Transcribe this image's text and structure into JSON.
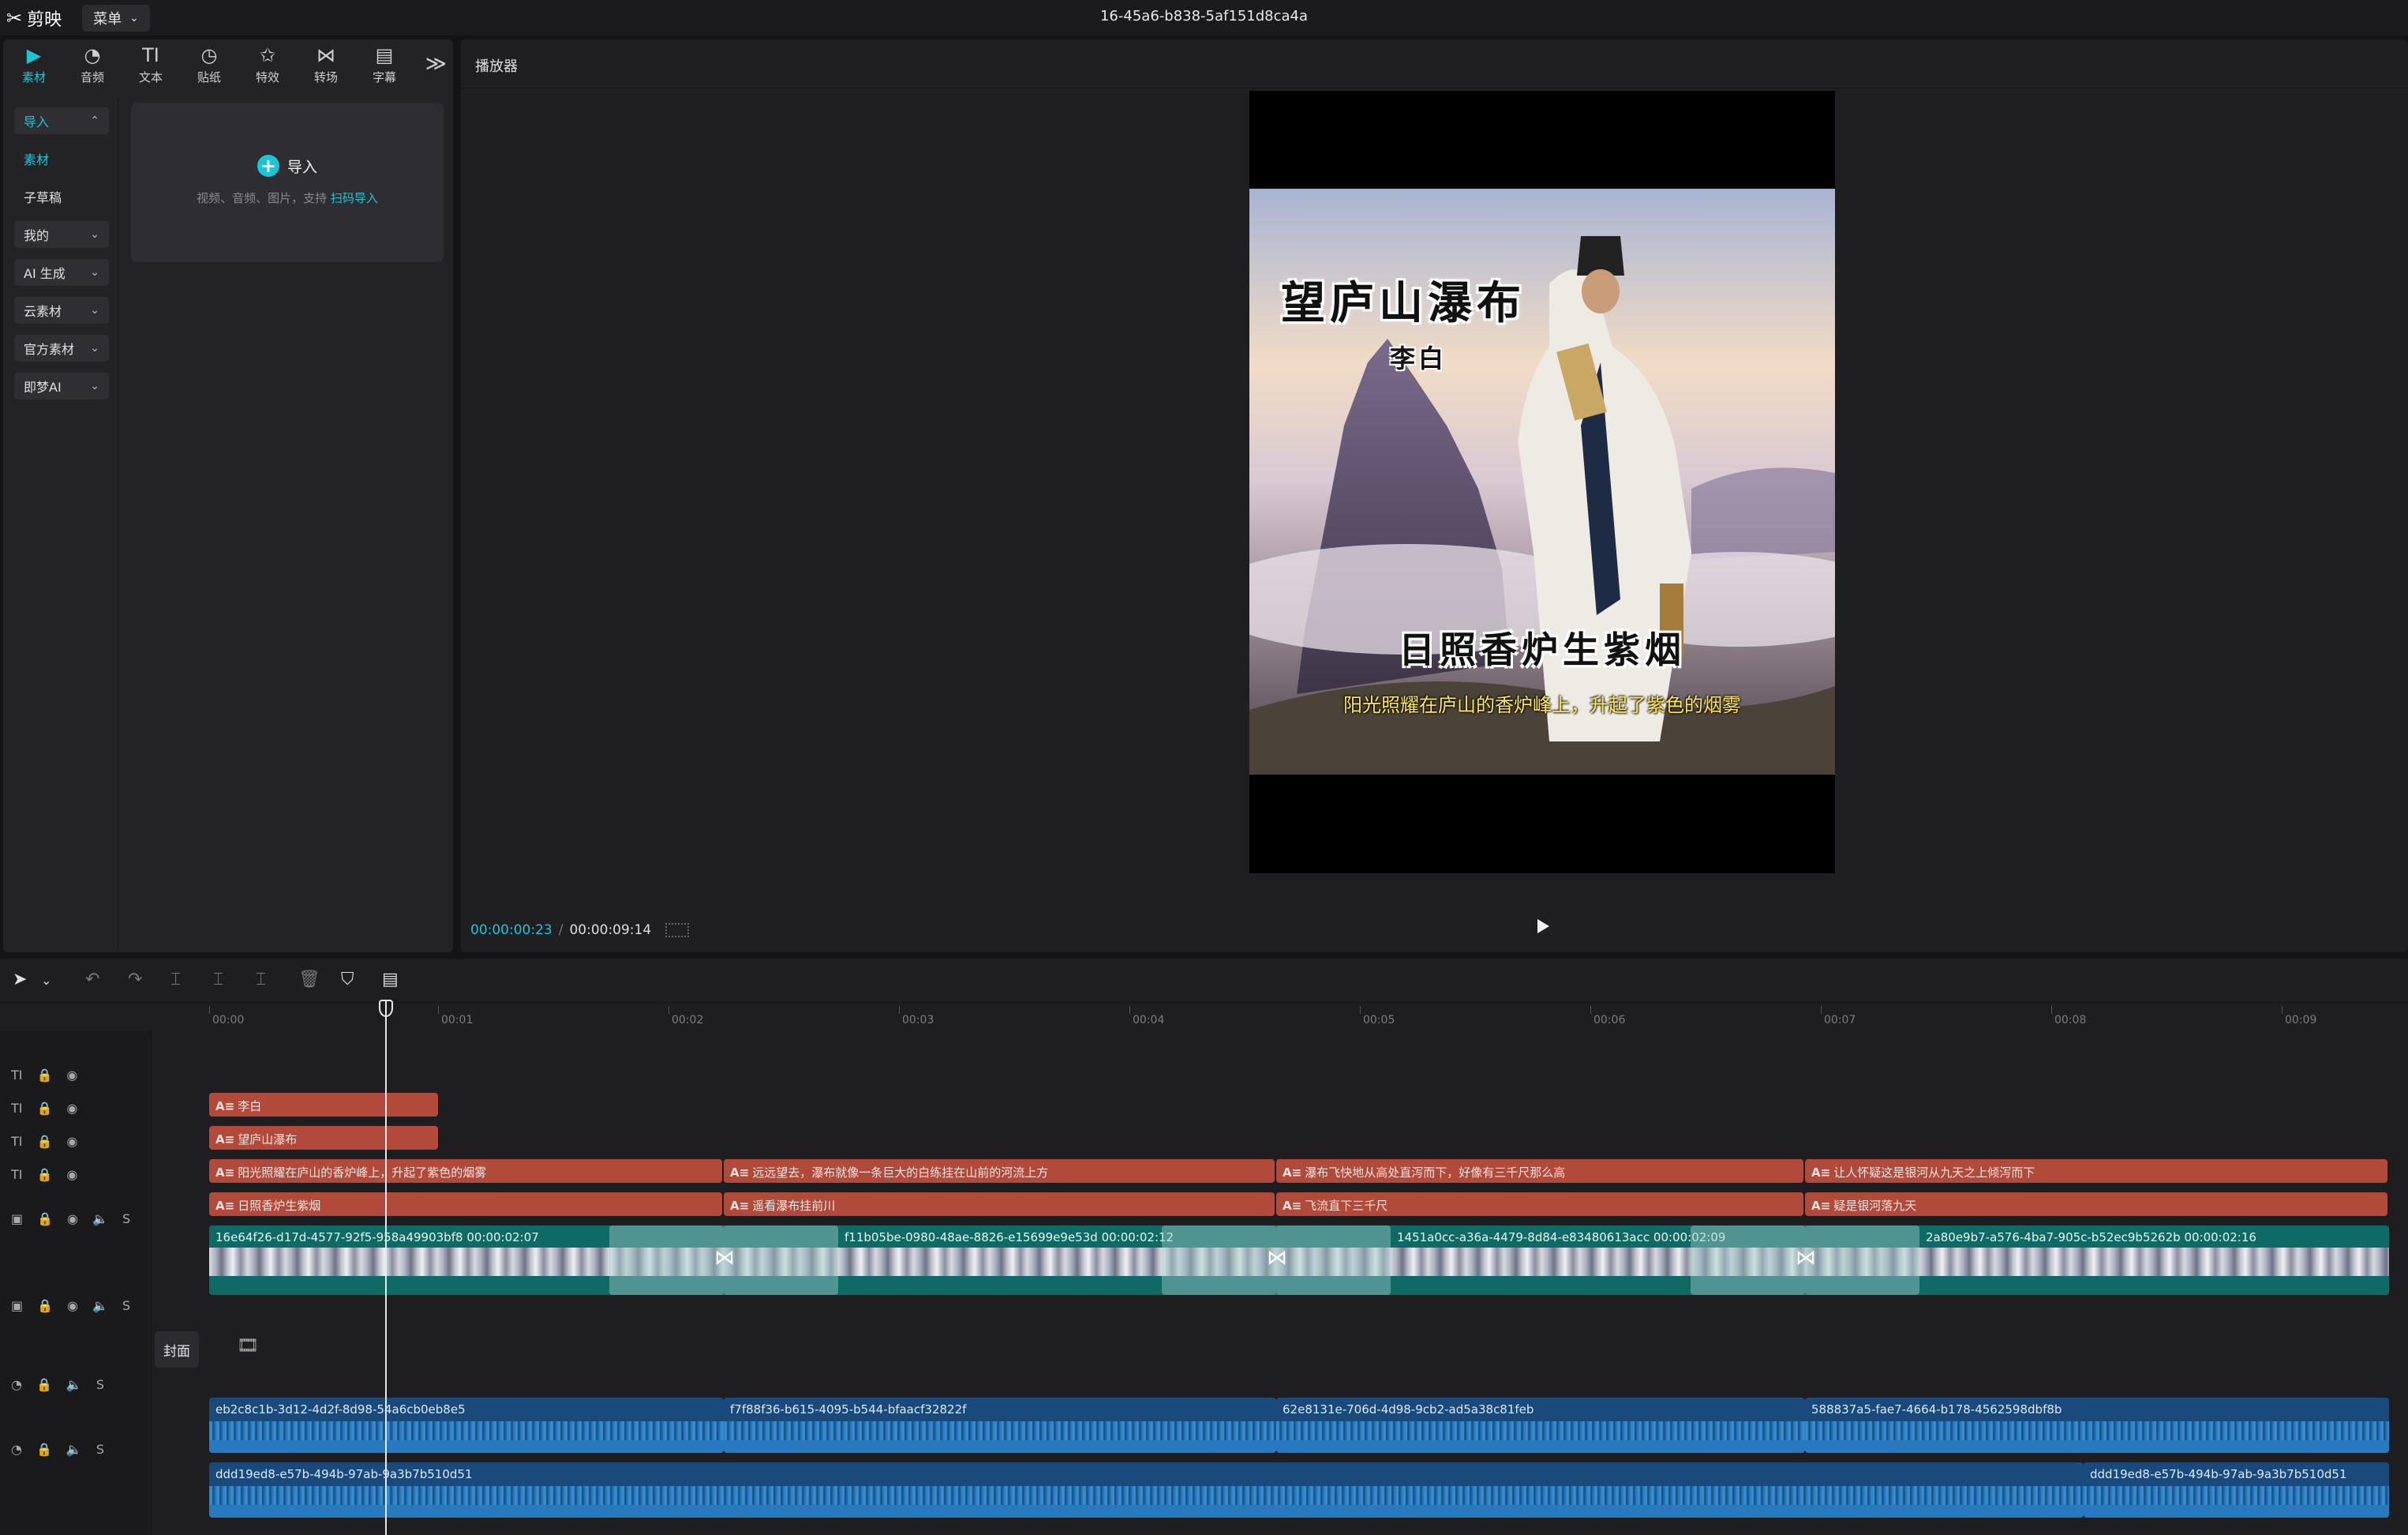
{
  "titlebar": {
    "app_name": "剪映",
    "menu_label": "菜单",
    "doc_title": "16-45a6-b838-5af151d8ca4a"
  },
  "tool_tabs": [
    {
      "label": "素材",
      "icon": "media-icon",
      "glyph": "▶"
    },
    {
      "label": "音频",
      "icon": "audio-icon",
      "glyph": "◔"
    },
    {
      "label": "文本",
      "icon": "text-icon",
      "glyph": "TI"
    },
    {
      "label": "贴纸",
      "icon": "sticker-icon",
      "glyph": "◷"
    },
    {
      "label": "特效",
      "icon": "effects-icon",
      "glyph": "✩"
    },
    {
      "label": "转场",
      "icon": "transition-icon",
      "glyph": "⋈"
    },
    {
      "label": "字幕",
      "icon": "caption-icon",
      "glyph": "▤"
    }
  ],
  "categories": [
    {
      "label": "导入",
      "chev": "⌃"
    },
    {
      "label": "素材",
      "chev": ""
    },
    {
      "label": "子草稿",
      "chev": ""
    },
    {
      "label": "我的",
      "chev": "⌄"
    },
    {
      "label": "AI 生成",
      "chev": "⌄"
    },
    {
      "label": "云素材",
      "chev": "⌄"
    },
    {
      "label": "官方素材",
      "chev": "⌄"
    },
    {
      "label": "即梦AI",
      "chev": "⌄"
    }
  ],
  "import_card": {
    "button_label": "导入",
    "hint_prefix": "视频、音频、图片，支持",
    "hint_link": "扫码导入"
  },
  "player": {
    "panel_title": "播放器",
    "overlay_title": "望庐山瀑布",
    "overlay_author": "李白",
    "overlay_verse": "日照香炉生紫烟",
    "overlay_subtitle": "阳光照耀在庐山的香炉峰上，升起了紫色的烟雾",
    "time_current": "00:00:00:23",
    "time_separator": "/",
    "time_total": "00:00:09:14"
  },
  "ruler": [
    "00:00",
    "00:01",
    "00:02",
    "00:03",
    "00:04",
    "00:05",
    "00:06",
    "00:07",
    "00:08",
    "00:09"
  ],
  "text_tracks": [
    [
      {
        "text": "李白"
      }
    ],
    [
      {
        "text": "望庐山瀑布"
      }
    ],
    [
      {
        "text": "阳光照耀在庐山的香炉峰上，升起了紫色的烟雾"
      },
      {
        "text": "远远望去，瀑布就像一条巨大的白练挂在山前的河流上方"
      },
      {
        "text": "瀑布飞快地从高处直泻而下，好像有三千尺那么高"
      },
      {
        "text": "让人怀疑这是银河从九天之上倾泻而下"
      }
    ],
    [
      {
        "text": "日照香炉生紫烟"
      },
      {
        "text": "遥看瀑布挂前川"
      },
      {
        "text": "飞流直下三千尺"
      },
      {
        "text": "疑是银河落九天"
      }
    ]
  ],
  "video_clips": [
    {
      "id": "16e64f26-d17d-4577-92f5-958a49903bf8",
      "duration": "00:00:02:07"
    },
    {
      "id": "f11b05be-0980-48ae-8826-e15699e9e53d",
      "duration": "00:00:02:12"
    },
    {
      "id": "1451a0cc-a36a-4479-8d84-e83480613acc",
      "duration": "00:00:02:09"
    },
    {
      "id": "2a80e9b7-a576-4ba7-905c-b52ec9b5262b",
      "duration": "00:00:02:16"
    }
  ],
  "cover_label": "封面",
  "audio_clips_1": [
    {
      "id": "eb2c8c1b-3d12-4d2f-8d98-54a6cb0eb8e5"
    },
    {
      "id": "f7f88f36-b615-4095-b544-bfaacf32822f"
    },
    {
      "id": "62e8131e-706d-4d98-9cb2-ad5a38c81feb"
    },
    {
      "id": "588837a5-fae7-4664-b178-4562598dbf8b"
    }
  ],
  "audio_clips_2": [
    {
      "id": "ddd19ed8-e57b-494b-97ab-9a3b7b510d51"
    },
    {
      "id": "ddd19ed8-e57b-494b-97ab-9a3b7b510d51"
    }
  ],
  "colors": {
    "accent": "#1ec4d6",
    "text_clip": "#b24a3c",
    "video_clip": "#0f6a66",
    "audio_clip": "#1a4a7c"
  }
}
